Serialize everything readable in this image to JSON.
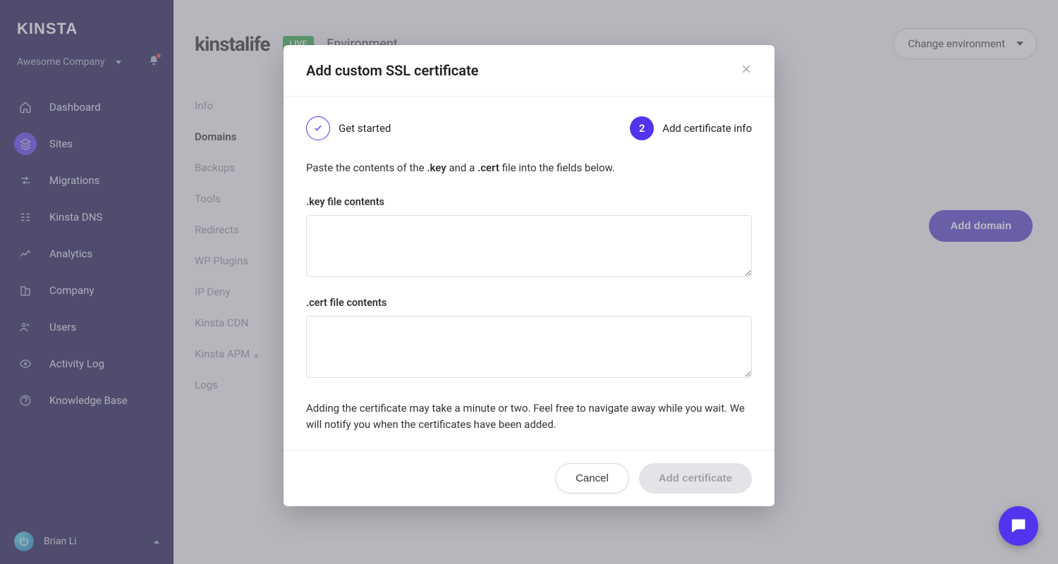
{
  "brand": "KINSTA",
  "company_name": "Awesome Company",
  "nav": {
    "dashboard": "Dashboard",
    "sites": "Sites",
    "migrations": "Migrations",
    "dns": "Kinsta DNS",
    "analytics": "Analytics",
    "company": "Company",
    "users": "Users",
    "activity": "Activity Log",
    "kb": "Knowledge Base"
  },
  "user_name": "Brian Li",
  "header": {
    "site_title": "kinstalife",
    "env_badge": "LIVE",
    "env_label": "Environment",
    "change_env": "Change environment"
  },
  "subnav": {
    "info": "Info",
    "domains": "Domains",
    "backups": "Backups",
    "tools": "Tools",
    "redirects": "Redirects",
    "plugins": "WP Plugins",
    "ipdeny": "IP Deny",
    "cdn": "Kinsta CDN",
    "apm": "Kinsta APM",
    "logs": "Logs"
  },
  "add_domain_btn": "Add domain",
  "modal": {
    "title": "Add custom SSL certificate",
    "step1_label": "Get started",
    "step2_num": "2",
    "step2_label": "Add certificate info",
    "instruction_pre": "Paste the contents of the ",
    "instruction_key": ".key",
    "instruction_mid": " and a ",
    "instruction_cert": ".cert",
    "instruction_post": " file into the fields below.",
    "key_label": ".key file contents",
    "cert_label": ".cert file contents",
    "key_value": "",
    "cert_value": "",
    "note": "Adding the certificate may take a minute or two. Feel free to navigate away while you wait. We will notify you when the certificates have been added.",
    "cancel": "Cancel",
    "submit": "Add certificate"
  }
}
